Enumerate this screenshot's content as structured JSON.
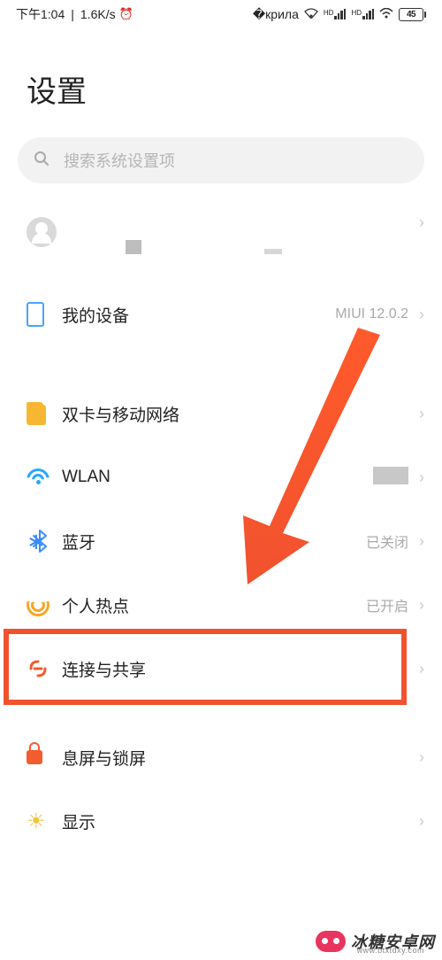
{
  "status": {
    "time": "下午1:04",
    "speed": "1.6K/s",
    "battery_pct": "45"
  },
  "page": {
    "title": "设置"
  },
  "search": {
    "placeholder": "搜索系统设置项"
  },
  "rows": {
    "device": {
      "label": "我的设备",
      "value": "MIUI 12.0.2"
    },
    "sim": {
      "label": "双卡与移动网络"
    },
    "wlan": {
      "label": "WLAN"
    },
    "bluetooth": {
      "label": "蓝牙",
      "value": "已关闭"
    },
    "hotspot": {
      "label": "个人热点",
      "value": "已开启"
    },
    "connection": {
      "label": "连接与共享"
    },
    "lockscreen": {
      "label": "息屏与锁屏"
    },
    "display": {
      "label": "显示"
    }
  },
  "watermark": {
    "name": "冰糖安卓网",
    "url": "www.btxtdxy.com"
  }
}
